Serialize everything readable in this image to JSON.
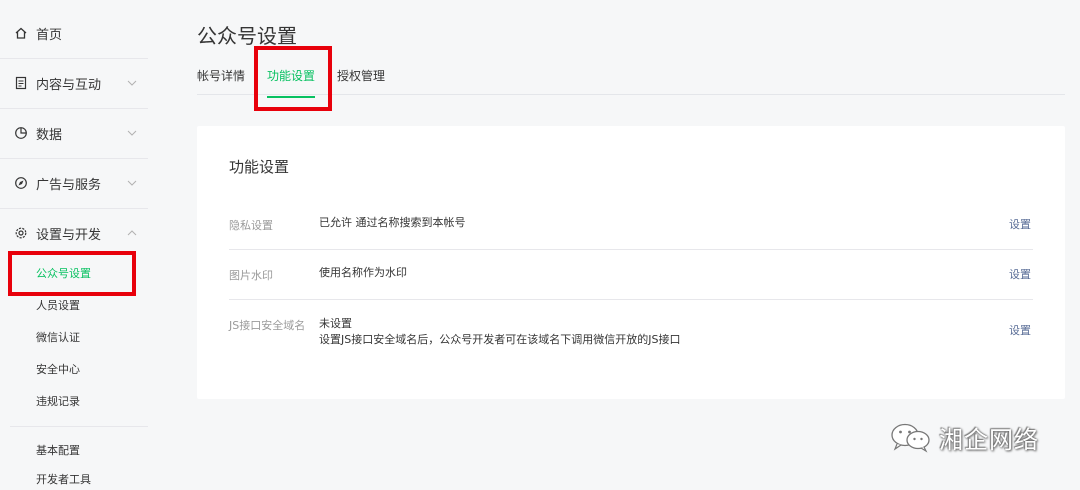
{
  "sidebar": {
    "home": {
      "label": "首页",
      "icon": "home-icon"
    },
    "content": {
      "label": "内容与互动",
      "icon": "document-icon"
    },
    "data": {
      "label": "数据",
      "icon": "pie-chart-icon"
    },
    "ads": {
      "label": "广告与服务",
      "icon": "compass-icon"
    },
    "settings": {
      "label": "设置与开发",
      "icon": "gear-icon"
    },
    "settings_items": [
      {
        "label": "公众号设置",
        "active": true
      },
      {
        "label": "人员设置"
      },
      {
        "label": "微信认证"
      },
      {
        "label": "安全中心"
      },
      {
        "label": "违规记录"
      }
    ],
    "dev_items": [
      {
        "label": "基本配置"
      },
      {
        "label": "开发者工具"
      }
    ]
  },
  "header": {
    "title": "公众号设置"
  },
  "tabs": [
    {
      "label": "帐号详情"
    },
    {
      "label": "功能设置",
      "active": true
    },
    {
      "label": "授权管理"
    }
  ],
  "card": {
    "title": "功能设置",
    "rows": [
      {
        "label": "隐私设置",
        "value": "已允许 通过名称搜索到本帐号",
        "action": "设置"
      },
      {
        "label": "图片水印",
        "value": "使用名称作为水印",
        "action": "设置"
      },
      {
        "label": "JS接口安全域名",
        "value": "未设置",
        "value2": "设置JS接口安全域名后，公众号开发者可在该域名下调用微信开放的JS接口",
        "action": "设置"
      }
    ]
  },
  "watermark": {
    "text": "湘企网络"
  },
  "colors": {
    "accent": "#07c160",
    "highlight_box": "#e8000b",
    "link": "#576b95"
  }
}
